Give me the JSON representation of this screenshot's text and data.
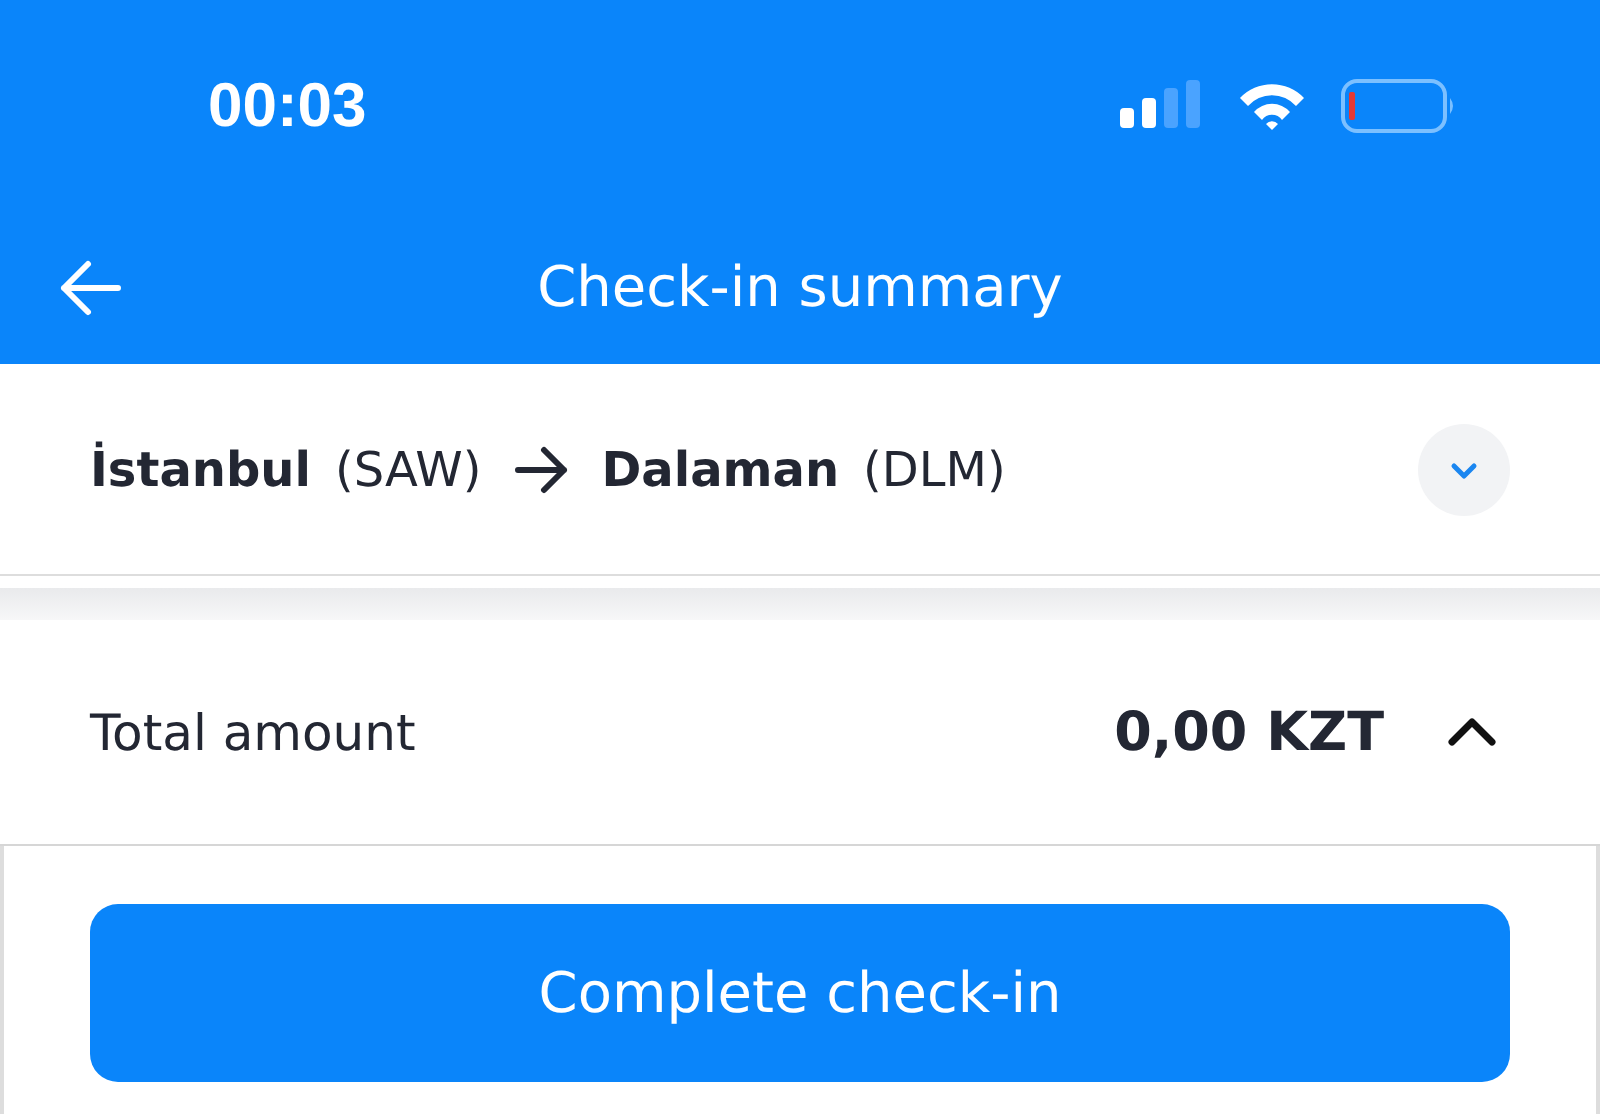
{
  "status_bar": {
    "time": "00:03"
  },
  "header": {
    "title": "Check-in summary"
  },
  "route": {
    "from_city": "İstanbul",
    "from_code": "(SAW)",
    "to_city": "Dalaman",
    "to_code": "(DLM)",
    "expanded": false
  },
  "total": {
    "label": "Total amount",
    "amount": "0,00 KZT",
    "expanded": true
  },
  "primary_button": {
    "label": "Complete check-in"
  }
}
